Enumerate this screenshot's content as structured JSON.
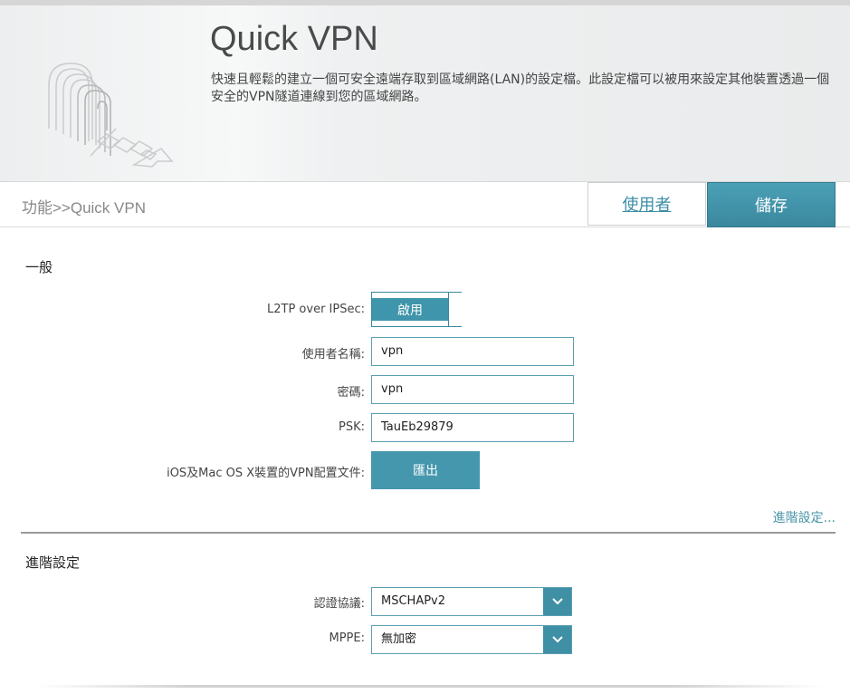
{
  "header": {
    "title": "Quick VPN",
    "description": "快速且輕鬆的建立一個可安全遠端存取到區域網路(LAN)的設定檔。此設定檔可以被用來設定其他裝置透過一個安全的VPN隧道連線到您的區域網路。",
    "logo_icon": "vpn-tunnel-icon"
  },
  "breadcrumb": "功能>>Quick VPN",
  "toolbar": {
    "user_label": "使用者",
    "save_label": "儲存"
  },
  "general": {
    "section_title": "一般",
    "l2tp_label": "L2TP over IPSec:",
    "l2tp_toggle_label": "啟用",
    "l2tp_enabled": true,
    "username_label": "使用者名稱:",
    "username_value": "vpn",
    "password_label": "密碼:",
    "password_value": "vpn",
    "psk_label": "PSK:",
    "psk_value": "TauEb29879",
    "export_label": "iOS及Mac OS X裝置的VPN配置文件:",
    "export_button": "匯出",
    "advanced_link": "進階設定..."
  },
  "advanced": {
    "section_title": "進階設定",
    "auth_label": "認證協議:",
    "auth_value": "MSCHAPv2",
    "mppe_label": "MPPE:",
    "mppe_value": "無加密"
  },
  "colors": {
    "accent": "#3f95ab",
    "link": "#3e8ea6"
  }
}
